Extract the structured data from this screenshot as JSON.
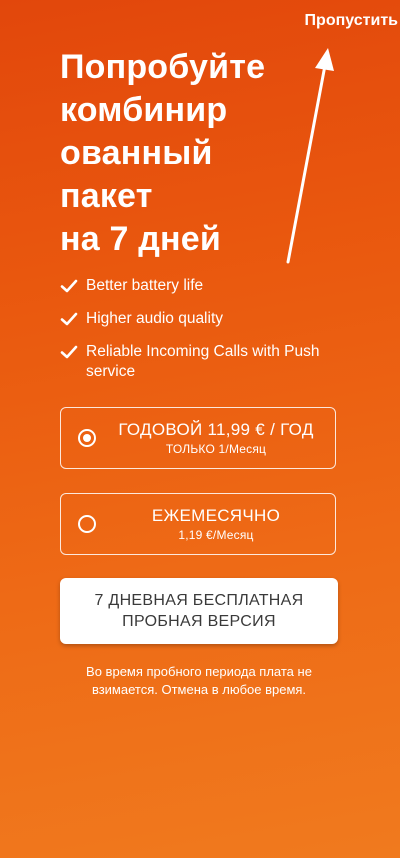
{
  "header": {
    "skip_label": "Пропустить"
  },
  "promo": {
    "headline": "Попробуйте\nкомбинир\nованный\nпакет\nна 7 дней",
    "features": [
      "Better battery life",
      "Higher audio quality",
      "Reliable Incoming Calls with Push service"
    ]
  },
  "plans": [
    {
      "title": "ГОДОВОЙ 11,99 € / ГОД",
      "subtitle": "ТОЛЬКО 1/Месяц",
      "selected": true
    },
    {
      "title": "ЕЖЕМЕСЯЧНО",
      "subtitle": "1,19 €/Месяц",
      "selected": false
    }
  ],
  "cta": {
    "label": "7 ДНЕВНАЯ БЕСПЛАТНАЯ\nПРОБНАЯ ВЕРСИЯ"
  },
  "disclaimer": "Во время пробного периода плата не взимается. Отмена в любое время.",
  "colors": {
    "background_top": "#e2470c",
    "background_bottom": "#f07a1e",
    "text": "#ffffff",
    "button_bg": "#ffffff",
    "button_text": "#3a3a3a"
  },
  "icons": {
    "feature_bullet": "check-icon",
    "skip_pointer": "arrow-up-icon"
  }
}
